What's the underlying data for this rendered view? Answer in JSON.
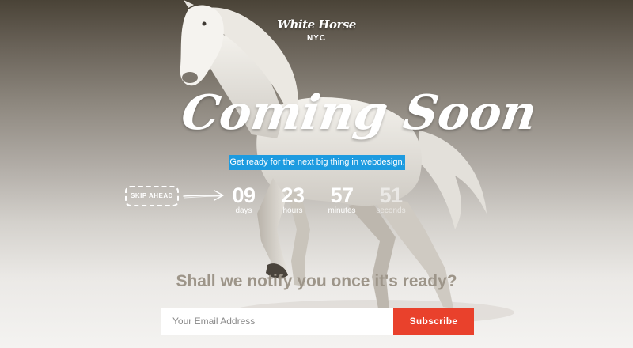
{
  "brand": {
    "name": "White Horse",
    "location": "NYC"
  },
  "hero": {
    "headline": "Coming Soon",
    "tagline": "Get ready for the next big thing in webdesign."
  },
  "countdown": {
    "skip_label": "SKIP AHEAD",
    "units": [
      {
        "value": "09",
        "label": "days"
      },
      {
        "value": "23",
        "label": "hours"
      },
      {
        "value": "57",
        "label": "minutes"
      },
      {
        "value": "51",
        "label": "seconds"
      }
    ]
  },
  "signup": {
    "prompt": "Shall we notify you once it's ready?",
    "email_placeholder": "Your Email Address",
    "button_label": "Subscribe"
  },
  "colors": {
    "accent_blue": "#1d9be0",
    "subscribe_red": "#e9412c",
    "prompt_text": "#9d9589"
  }
}
